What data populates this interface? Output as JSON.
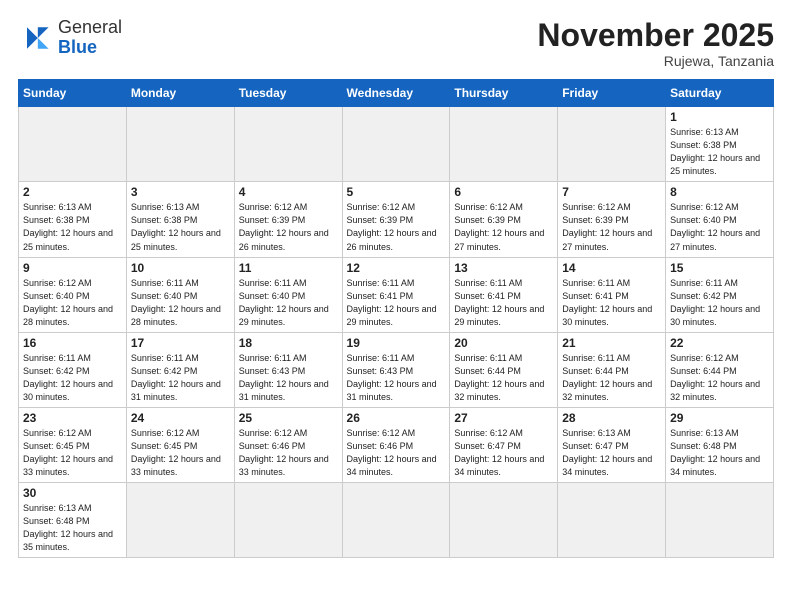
{
  "header": {
    "logo_general": "General",
    "logo_blue": "Blue",
    "month_title": "November 2025",
    "subtitle": "Rujewa, Tanzania"
  },
  "weekdays": [
    "Sunday",
    "Monday",
    "Tuesday",
    "Wednesday",
    "Thursday",
    "Friday",
    "Saturday"
  ],
  "weeks": [
    [
      {
        "day": "",
        "info": "",
        "empty": true
      },
      {
        "day": "",
        "info": "",
        "empty": true
      },
      {
        "day": "",
        "info": "",
        "empty": true
      },
      {
        "day": "",
        "info": "",
        "empty": true
      },
      {
        "day": "",
        "info": "",
        "empty": true
      },
      {
        "day": "",
        "info": "",
        "empty": true
      },
      {
        "day": "1",
        "info": "Sunrise: 6:13 AM\nSunset: 6:38 PM\nDaylight: 12 hours\nand 25 minutes."
      }
    ],
    [
      {
        "day": "2",
        "info": "Sunrise: 6:13 AM\nSunset: 6:38 PM\nDaylight: 12 hours\nand 25 minutes."
      },
      {
        "day": "3",
        "info": "Sunrise: 6:13 AM\nSunset: 6:38 PM\nDaylight: 12 hours\nand 25 minutes."
      },
      {
        "day": "4",
        "info": "Sunrise: 6:12 AM\nSunset: 6:39 PM\nDaylight: 12 hours\nand 26 minutes."
      },
      {
        "day": "5",
        "info": "Sunrise: 6:12 AM\nSunset: 6:39 PM\nDaylight: 12 hours\nand 26 minutes."
      },
      {
        "day": "6",
        "info": "Sunrise: 6:12 AM\nSunset: 6:39 PM\nDaylight: 12 hours\nand 27 minutes."
      },
      {
        "day": "7",
        "info": "Sunrise: 6:12 AM\nSunset: 6:39 PM\nDaylight: 12 hours\nand 27 minutes."
      },
      {
        "day": "8",
        "info": "Sunrise: 6:12 AM\nSunset: 6:40 PM\nDaylight: 12 hours\nand 27 minutes."
      }
    ],
    [
      {
        "day": "9",
        "info": "Sunrise: 6:12 AM\nSunset: 6:40 PM\nDaylight: 12 hours\nand 28 minutes."
      },
      {
        "day": "10",
        "info": "Sunrise: 6:11 AM\nSunset: 6:40 PM\nDaylight: 12 hours\nand 28 minutes."
      },
      {
        "day": "11",
        "info": "Sunrise: 6:11 AM\nSunset: 6:40 PM\nDaylight: 12 hours\nand 29 minutes."
      },
      {
        "day": "12",
        "info": "Sunrise: 6:11 AM\nSunset: 6:41 PM\nDaylight: 12 hours\nand 29 minutes."
      },
      {
        "day": "13",
        "info": "Sunrise: 6:11 AM\nSunset: 6:41 PM\nDaylight: 12 hours\nand 29 minutes."
      },
      {
        "day": "14",
        "info": "Sunrise: 6:11 AM\nSunset: 6:41 PM\nDaylight: 12 hours\nand 30 minutes."
      },
      {
        "day": "15",
        "info": "Sunrise: 6:11 AM\nSunset: 6:42 PM\nDaylight: 12 hours\nand 30 minutes."
      }
    ],
    [
      {
        "day": "16",
        "info": "Sunrise: 6:11 AM\nSunset: 6:42 PM\nDaylight: 12 hours\nand 30 minutes."
      },
      {
        "day": "17",
        "info": "Sunrise: 6:11 AM\nSunset: 6:42 PM\nDaylight: 12 hours\nand 31 minutes."
      },
      {
        "day": "18",
        "info": "Sunrise: 6:11 AM\nSunset: 6:43 PM\nDaylight: 12 hours\nand 31 minutes."
      },
      {
        "day": "19",
        "info": "Sunrise: 6:11 AM\nSunset: 6:43 PM\nDaylight: 12 hours\nand 31 minutes."
      },
      {
        "day": "20",
        "info": "Sunrise: 6:11 AM\nSunset: 6:44 PM\nDaylight: 12 hours\nand 32 minutes."
      },
      {
        "day": "21",
        "info": "Sunrise: 6:11 AM\nSunset: 6:44 PM\nDaylight: 12 hours\nand 32 minutes."
      },
      {
        "day": "22",
        "info": "Sunrise: 6:12 AM\nSunset: 6:44 PM\nDaylight: 12 hours\nand 32 minutes."
      }
    ],
    [
      {
        "day": "23",
        "info": "Sunrise: 6:12 AM\nSunset: 6:45 PM\nDaylight: 12 hours\nand 33 minutes."
      },
      {
        "day": "24",
        "info": "Sunrise: 6:12 AM\nSunset: 6:45 PM\nDaylight: 12 hours\nand 33 minutes."
      },
      {
        "day": "25",
        "info": "Sunrise: 6:12 AM\nSunset: 6:46 PM\nDaylight: 12 hours\nand 33 minutes."
      },
      {
        "day": "26",
        "info": "Sunrise: 6:12 AM\nSunset: 6:46 PM\nDaylight: 12 hours\nand 34 minutes."
      },
      {
        "day": "27",
        "info": "Sunrise: 6:12 AM\nSunset: 6:47 PM\nDaylight: 12 hours\nand 34 minutes."
      },
      {
        "day": "28",
        "info": "Sunrise: 6:13 AM\nSunset: 6:47 PM\nDaylight: 12 hours\nand 34 minutes."
      },
      {
        "day": "29",
        "info": "Sunrise: 6:13 AM\nSunset: 6:48 PM\nDaylight: 12 hours\nand 34 minutes."
      }
    ],
    [
      {
        "day": "30",
        "info": "Sunrise: 6:13 AM\nSunset: 6:48 PM\nDaylight: 12 hours\nand 35 minutes."
      },
      {
        "day": "",
        "info": "",
        "empty": true
      },
      {
        "day": "",
        "info": "",
        "empty": true
      },
      {
        "day": "",
        "info": "",
        "empty": true
      },
      {
        "day": "",
        "info": "",
        "empty": true
      },
      {
        "day": "",
        "info": "",
        "empty": true
      },
      {
        "day": "",
        "info": "",
        "empty": true
      }
    ]
  ]
}
